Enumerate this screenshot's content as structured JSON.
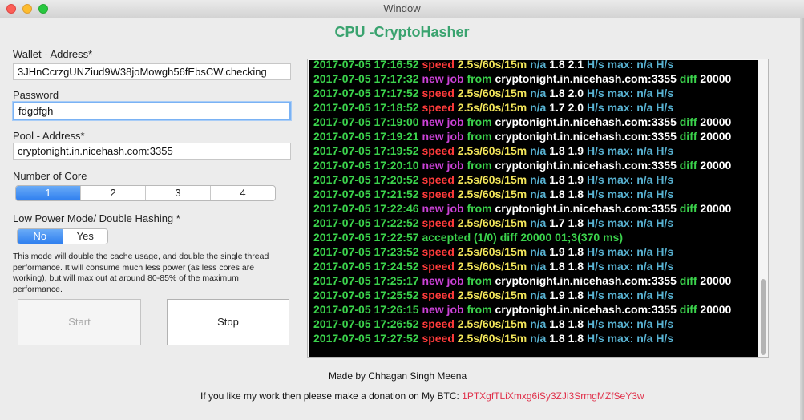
{
  "window": {
    "title": "Window"
  },
  "app_title": "CPU -CryptoHasher",
  "form": {
    "wallet_label": "Wallet - Address*",
    "wallet_value": "3JHnCcrzgUNZiud9W38joMowgh56fEbsCW.checking",
    "password_label": "Password",
    "password_value": "fdgdfgh",
    "pool_label": "Pool - Address*",
    "pool_value": "cryptonight.in.nicehash.com:3355",
    "cores_label": "Number of Core",
    "cores": [
      "1",
      "2",
      "3",
      "4"
    ],
    "cores_selected": "1",
    "lowpower_label": "Low Power Mode/ Double Hashing *",
    "lowpower_no": "No",
    "lowpower_yes": "Yes",
    "lowpower_selected": "No",
    "note": "This mode will double the cache usage, and double the single thread performance. It will  consume much less power (as less cores are working), but will max out at around 80-85% of the maximum performance."
  },
  "buttons": {
    "start": "Start",
    "stop": "Stop"
  },
  "log": [
    {
      "kind": "speed",
      "time": "2017-07-05 17:16:52",
      "v1": "1.8",
      "v2": "2.1"
    },
    {
      "kind": "job",
      "time": "2017-07-05 17:17:32"
    },
    {
      "kind": "speed",
      "time": "2017-07-05 17:17:52",
      "v1": "1.8",
      "v2": "2.0"
    },
    {
      "kind": "speed",
      "time": "2017-07-05 17:18:52",
      "v1": "1.7",
      "v2": "2.0"
    },
    {
      "kind": "job",
      "time": "2017-07-05 17:19:00"
    },
    {
      "kind": "job",
      "time": "2017-07-05 17:19:21"
    },
    {
      "kind": "speed",
      "time": "2017-07-05 17:19:52",
      "v1": "1.8",
      "v2": "1.9"
    },
    {
      "kind": "job",
      "time": "2017-07-05 17:20:10"
    },
    {
      "kind": "speed",
      "time": "2017-07-05 17:20:52",
      "v1": "1.8",
      "v2": "1.9"
    },
    {
      "kind": "speed",
      "time": "2017-07-05 17:21:52",
      "v1": "1.8",
      "v2": "1.8"
    },
    {
      "kind": "job",
      "time": "2017-07-05 17:22:46"
    },
    {
      "kind": "speed",
      "time": "2017-07-05 17:22:52",
      "v1": "1.7",
      "v2": "1.8"
    },
    {
      "kind": "accepted",
      "time": "2017-07-05 17:22:57",
      "text": "accepted (1/0) diff 20000 01;3(370 ms)"
    },
    {
      "kind": "speed",
      "time": "2017-07-05 17:23:52",
      "v1": "1.9",
      "v2": "1.8"
    },
    {
      "kind": "speed",
      "time": "2017-07-05 17:24:52",
      "v1": "1.8",
      "v2": "1.8"
    },
    {
      "kind": "job",
      "time": "2017-07-05 17:25:17"
    },
    {
      "kind": "speed",
      "time": "2017-07-05 17:25:52",
      "v1": "1.9",
      "v2": "1.8"
    },
    {
      "kind": "job",
      "time": "2017-07-05 17:26:15"
    },
    {
      "kind": "speed",
      "time": "2017-07-05 17:26:52",
      "v1": "1.8",
      "v2": "1.8"
    },
    {
      "kind": "speed",
      "time": "2017-07-05 17:27:52",
      "v1": "1.8",
      "v2": "1.8"
    }
  ],
  "log_tokens": {
    "speed": "speed",
    "speed_window": "2.5s/60s/15m",
    "na": "n/a",
    "hs_max": "H/s max:",
    "hs": "H/s",
    "new_job": "new job",
    "from": "from",
    "pool": "cryptonight.in.nicehash.com:3355",
    "diff": "diff",
    "diff_value": "20000"
  },
  "footer": {
    "credit": "Made by Chhagan Singh Meena",
    "donation_prefix": "If you like my work then please make a donation on My BTC: ",
    "btc_address": "1PTXgfTLiXmxg6iSy3ZJi3SrmgMZfSeY3w"
  },
  "colors": {
    "title_green": "#3aa36f",
    "segment_active": "#2f7fef",
    "log_green": "#3bd34c",
    "log_red": "#ff3b3b",
    "log_yellow": "#f2e55a",
    "log_cyan": "#58b2d2",
    "log_magenta": "#cc42d8",
    "btc_red": "#e0304a"
  }
}
